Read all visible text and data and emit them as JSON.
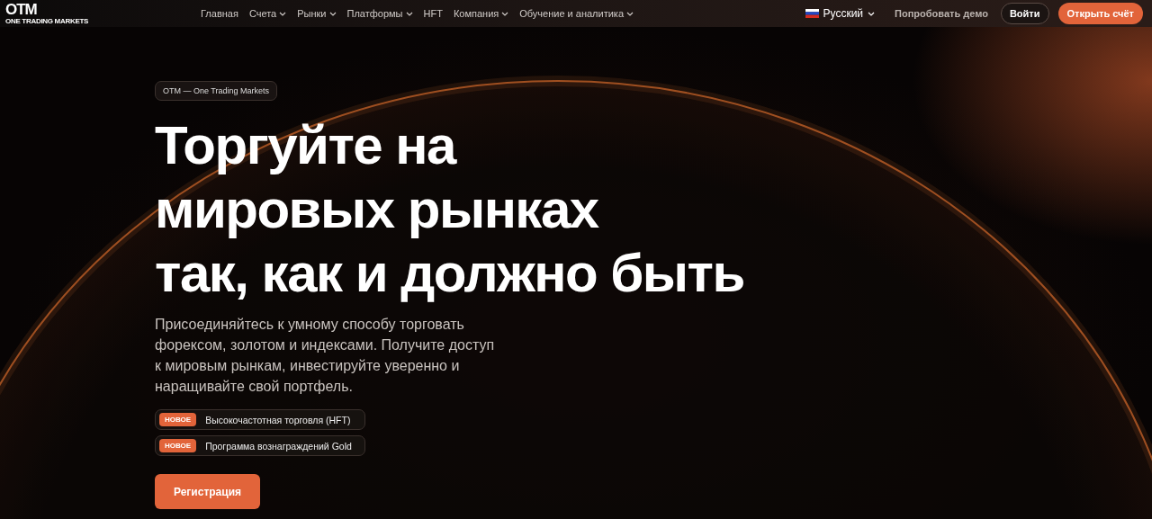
{
  "logo": {
    "mark": "OTM",
    "tagline": "ONE TRADING MARKETS"
  },
  "nav": [
    {
      "label": "Главная",
      "has_menu": false
    },
    {
      "label": "Счета",
      "has_menu": true
    },
    {
      "label": "Рынки",
      "has_menu": true
    },
    {
      "label": "Платформы",
      "has_menu": true
    },
    {
      "label": "HFT",
      "has_menu": false
    },
    {
      "label": "Компания",
      "has_menu": true
    },
    {
      "label": "Обучение и аналитика",
      "has_menu": true
    }
  ],
  "language": {
    "label": "Русский"
  },
  "actions": {
    "demo": "Попробовать демо",
    "login": "Войти",
    "open_account": "Открыть счёт"
  },
  "hero": {
    "eyebrow": "OTM — One Trading Markets",
    "headline": [
      "Торгуйте на",
      "мировых рынках",
      "так, как и должно быть"
    ],
    "description": "Присоединяйтесь к умному способу торговать форексом, золотом и индексами. Получите доступ к мировым рынкам, инвестируйте уверенно и наращивайте свой портфель.",
    "features": [
      {
        "badge": "НОВОЕ",
        "text": "Высокочастотная торговля (HFT)"
      },
      {
        "badge": "НОВОЕ",
        "text": "Программа вознаграждений Gold"
      }
    ],
    "cta": "Регистрация"
  }
}
